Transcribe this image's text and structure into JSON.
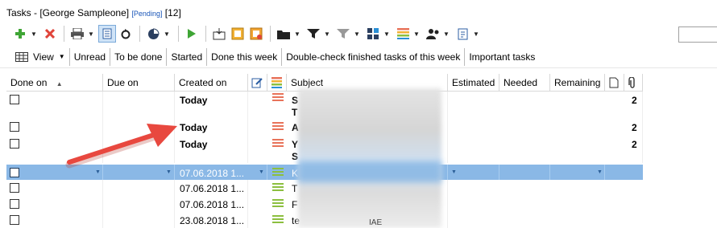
{
  "window": {
    "title": "Tasks - [George Sampleone]",
    "status": "[Pending]",
    "count": "[12]"
  },
  "toolbar": {
    "icons": [
      "add-icon",
      "delete-icon",
      "print-icon",
      "preview-icon",
      "refresh-icon",
      "pie-chart-icon",
      "play-icon",
      "inbox-icon",
      "export-icon",
      "import-icon",
      "folder-icon",
      "filter-icon",
      "filter-clear-icon",
      "categories-icon",
      "priority-icon",
      "users-icon",
      "script-icon"
    ]
  },
  "filters": {
    "view_label": "View",
    "items": [
      "Unread",
      "To be done",
      "Started",
      "Done this week",
      "Double-check finished tasks of this week",
      "Important tasks"
    ]
  },
  "columns": {
    "done_on": "Done on",
    "due_on": "Due on",
    "created_on": "Created on",
    "subject": "Subject",
    "estimated": "Estimated",
    "needed": "Needed",
    "remaining": "Remaining"
  },
  "rows": [
    {
      "created": "Today",
      "subject_line1": "S",
      "subject_line2": "T",
      "attachments": "2",
      "priority": "high"
    },
    {
      "created": "Today",
      "subject_line1": "A",
      "subject_line2": "",
      "attachments": "2",
      "priority": "high"
    },
    {
      "created": "Today",
      "subject_line1": "Y",
      "subject_line2": "S",
      "attachments": "2",
      "priority": "high"
    },
    {
      "created": "07.06.2018 1...",
      "subject_line1": "K",
      "subject_line2": "",
      "attachments": "",
      "priority": "normal"
    },
    {
      "created": "07.06.2018 1...",
      "subject_line1": "T",
      "subject_line2": "",
      "attachments": "",
      "priority": "normal"
    },
    {
      "created": "07.06.2018 1...",
      "subject_line1": "F",
      "subject_line2": "",
      "attachments": "",
      "priority": "normal"
    },
    {
      "created": "23.08.2018 1...",
      "subject_line1": "te",
      "subject_line2": "",
      "attachments": "",
      "priority": "normal"
    }
  ],
  "stray_text": "IAE",
  "colors": {
    "selection": "#8ab8e6",
    "priority_high": "#e8735a",
    "priority_normal": "#8cbf3f",
    "annotation_arrow": "#e8483f",
    "pending_link": "#1a56b8"
  }
}
